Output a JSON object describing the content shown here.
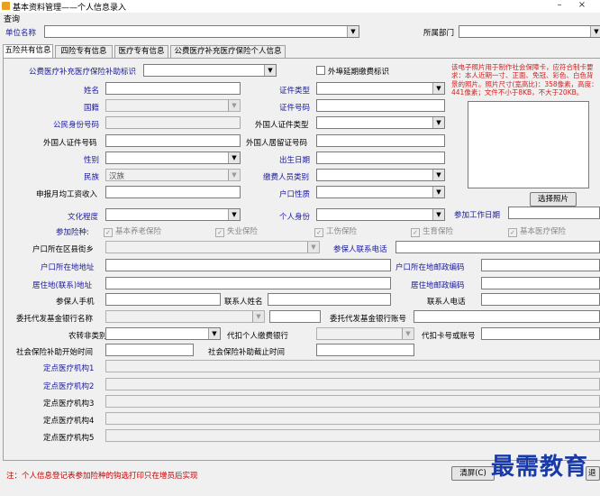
{
  "window": {
    "title": "基本资料管理——个人信息录入",
    "minimize": "–",
    "close": "×"
  },
  "menu": {
    "query": "查询"
  },
  "header": {
    "unit_label": "单位名称",
    "dept_label": "所属部门"
  },
  "tabs": [
    "五险共有信息",
    "四险专有信息",
    "医疗专有信息",
    "公费医疗补充医疗保险个人信息"
  ],
  "form": {
    "subsidy_label": "公费医疗补充医疗保险补助标识",
    "outside_label": "外埠延期缴费标识",
    "name_label": "姓名",
    "id_type_label": "证件类型",
    "nationality_label": "国籍",
    "id_no_label": "证件号码",
    "citizen_id_label": "公民身份号码",
    "foreign_id_type_label": "外国人证件类型",
    "foreign_id_no_label": "外国人证件号码",
    "foreign_permit_label": "外国人居留证号码",
    "gender_label": "性别",
    "birth_label": "出生日期",
    "ethnicity_label": "民族",
    "ethnicity_value": "汉族",
    "payer_category_label": "缴费人员类别",
    "monthly_wage_label": "申报月均工资收入",
    "hukou_label": "户口性质",
    "education_label": "文化程度",
    "identity_label": "个人身份",
    "work_date_label": "参加工作日期",
    "insurance_label": "参加险种:",
    "insurances": [
      "基本养老保险",
      "失业保险",
      "工伤保险",
      "生育保险",
      "基本医疗保险"
    ],
    "street_label": "户口所在区县街乡",
    "contact_phone_label": "参保人联系电话",
    "hukou_addr_label": "户口所在地地址",
    "hukou_zip_label": "户口所在地邮政编码",
    "residence_addr_label": "居住地(联系)地址",
    "residence_zip_label": "居住地邮政编码",
    "mobile_label": "参保人手机",
    "contact_name_label": "联系人姓名",
    "contact_tel_label": "联系人电话",
    "bank_name_label": "委托代发基金银行名称",
    "bank_acct_label": "委托代发基金银行账号",
    "agri_label": "农转非类别",
    "withhold_bank_label": "代扣个人缴费银行",
    "withhold_acct_label": "代扣卡号或账号",
    "ss_start_label": "社会保险补助开始时间",
    "ss_end_label": "社会保险补助截止时间",
    "hospitals": [
      "定点医疗机构1",
      "定点医疗机构2",
      "定点医疗机构3",
      "定点医疗机构4",
      "定点医疗机构5"
    ]
  },
  "photo_hint": "该电子照片用于制作社会保障卡，应符合制卡要求：本人近期一寸、正面、免冠、彩色、白色背景的照片。照片尺寸(宽高比)：358像素，高度：441像素；文件不小于8KB，不大于20KB。",
  "buttons": {
    "select_photo": "选择照片",
    "clear": "清屏(C)",
    "exit": "退出"
  },
  "note": "注：个人信息登记表参加险种的钩选打印只在增员后实现",
  "watermark": "最需教育"
}
